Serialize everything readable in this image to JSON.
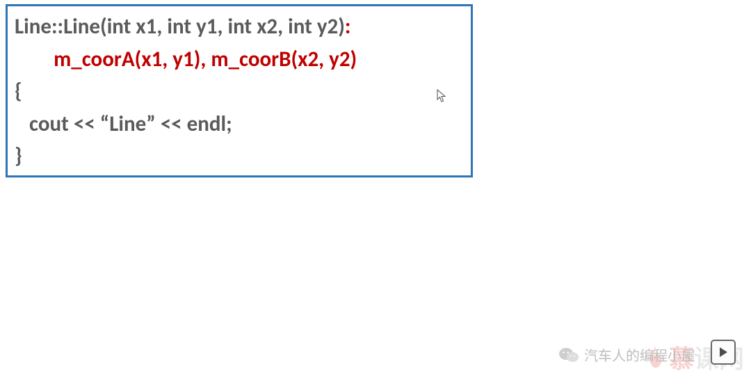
{
  "code": {
    "l1a": "Line::Line(int x1, int y1, int x2, int y2)",
    "l1b": ":",
    "l2": "        m_coorA(x1, y1), m_coorB(x2, y2)",
    "l3": "{",
    "l4": "   cout << “Line” << endl;",
    "l5": "}"
  },
  "watermark": {
    "icon": "wechat-icon",
    "text": "汽车人的编程小屋"
  },
  "brand": {
    "text": "慕课网"
  },
  "controls": {
    "play": "play-icon"
  }
}
